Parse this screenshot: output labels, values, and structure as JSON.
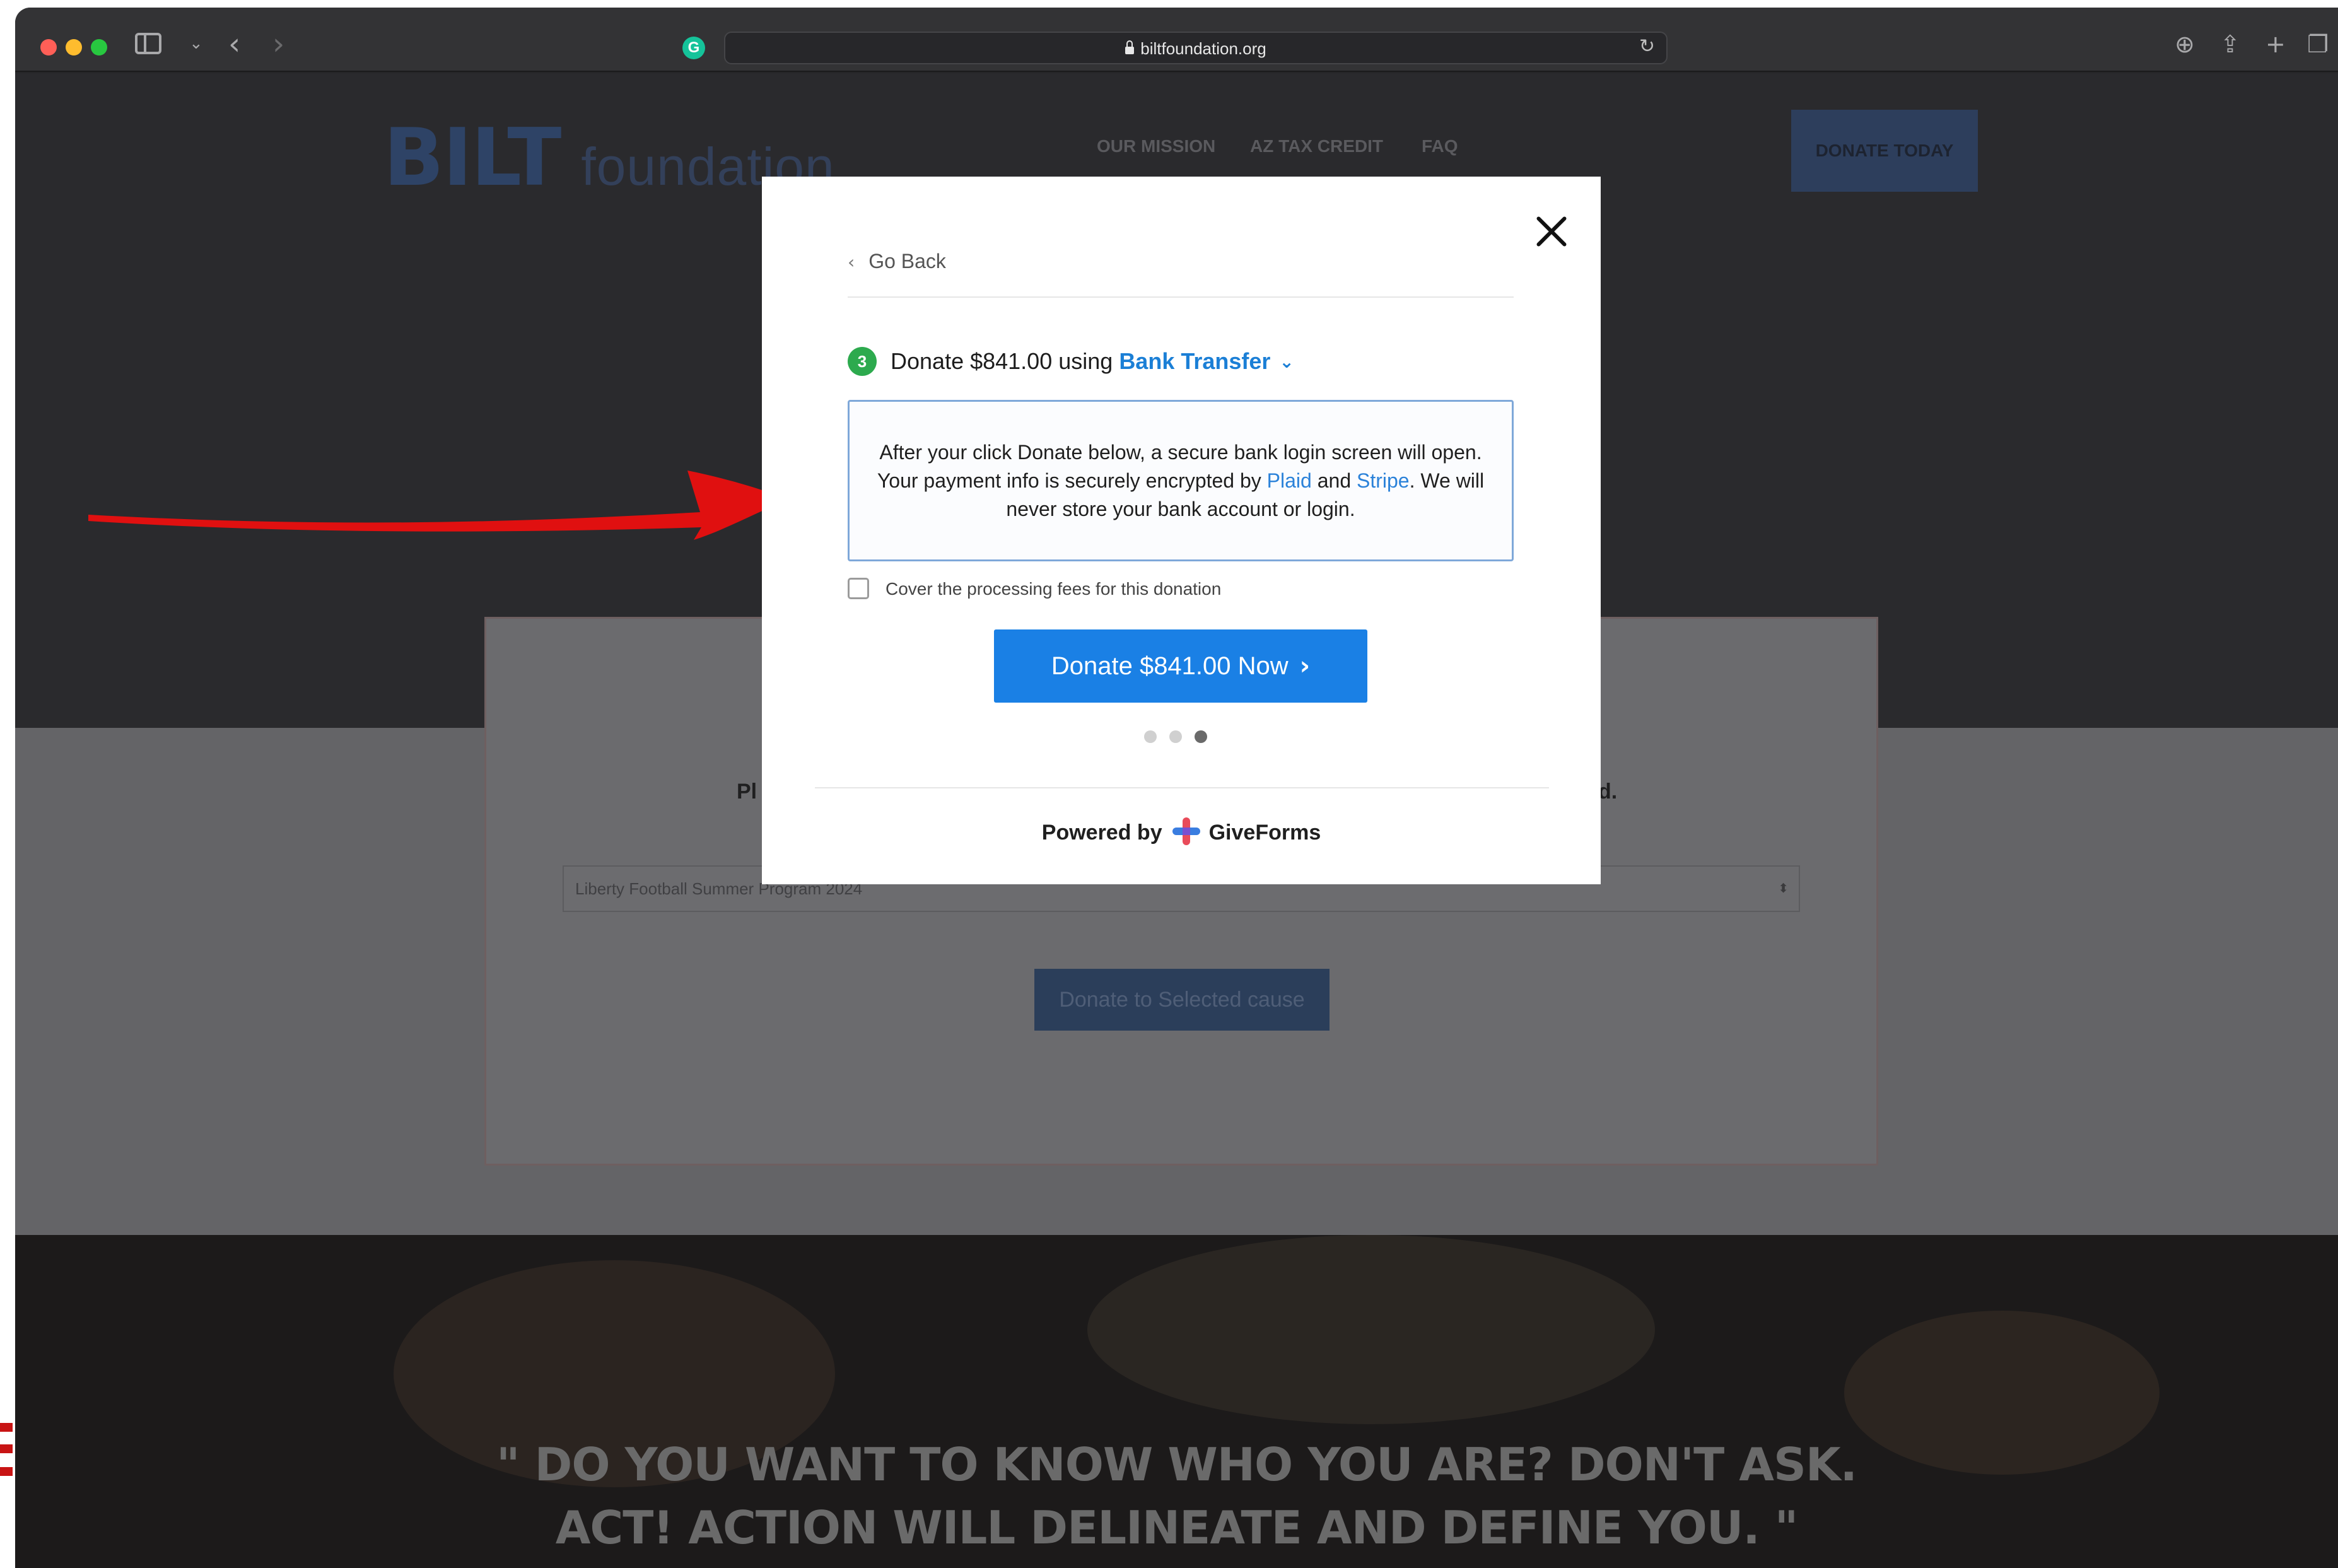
{
  "browser": {
    "url": "biltfoundation.org"
  },
  "site": {
    "logo_main": "BILT",
    "logo_sub": "foundation",
    "nav": [
      "OUR MISSION",
      "AZ TAX CREDIT",
      "FAQ"
    ],
    "donate_today": "DONATE TODAY",
    "card_heading_left": "Pl",
    "card_heading_right": "d.",
    "cause_select_value": "Liberty Football Summer Program 2024",
    "donate_selected_label": "Donate to Selected cause",
    "quote_line1": "\" DO YOU WANT TO KNOW WHO YOU ARE? DON'T ASK.",
    "quote_line2": "ACT! ACTION WILL DELINEATE AND DEFINE YOU. \""
  },
  "modal": {
    "go_back": "Go Back",
    "step_number": "3",
    "step_prefix": "Donate $841.00 using",
    "payment_method": "Bank Transfer",
    "info_part1": "After your click Donate below, a secure bank login screen will open. Your payment info is securely encrypted by",
    "info_link1": "Plaid",
    "info_part2": "and",
    "info_link2": "Stripe",
    "info_part3": ". We will never store your bank account or login.",
    "checkbox_label": "Cover the processing fees for this donation",
    "donate_button": "Donate $841.00 Now",
    "powered_by": "Powered by",
    "brand": "GiveForms"
  },
  "colors": {
    "primary_button": "#1a80e5",
    "step_badge": "#2daa4e",
    "link": "#2b82d9",
    "annotation_arrow": "#e01010"
  }
}
